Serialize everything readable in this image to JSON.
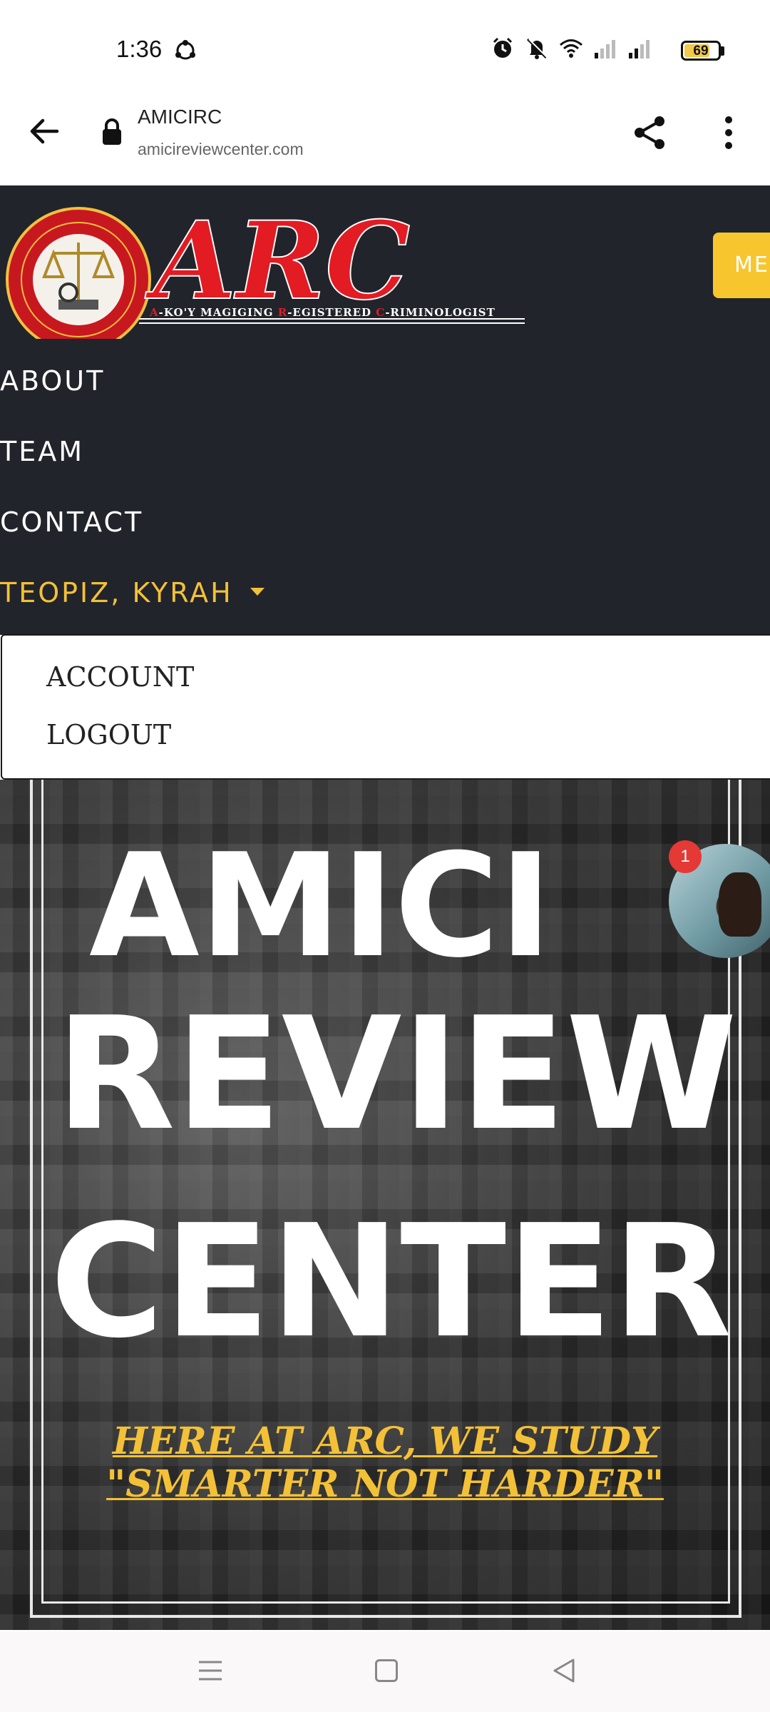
{
  "status_bar": {
    "time": "1:36",
    "battery": "69",
    "battery_level": 0.69,
    "icons": [
      "sync-icon",
      "alarm-icon",
      "mute-icon",
      "wifi-icon",
      "signal-icon",
      "signal-icon"
    ]
  },
  "browser": {
    "title": "AMICIRC",
    "url": "amicireviewcenter.com"
  },
  "header": {
    "logo_text": "ARC",
    "logo_subtitle_parts": [
      "A",
      "-KO'Y MAGIGING ",
      "R",
      "-EGISTERED ",
      "C",
      "-RIMINOLOGIST"
    ],
    "menu_button": "ME",
    "nav": [
      "ABOUT",
      "TEAM",
      "CONTACT"
    ],
    "user_name": "TEOPIZ, KYRAH"
  },
  "dropdown": {
    "items": [
      "ACCOUNT",
      "LOGOUT"
    ]
  },
  "hero": {
    "lines": [
      "AMICI",
      "REVIEW",
      "CENTER"
    ],
    "tagline_line1": "HERE AT ARC, WE STUDY",
    "tagline_line2": "\"SMARTER NOT HARDER\""
  },
  "chat": {
    "badge_count": "1"
  },
  "colors": {
    "header_bg": "#22242b",
    "accent_yellow": "#f3c137",
    "logo_red": "#e31b23"
  }
}
